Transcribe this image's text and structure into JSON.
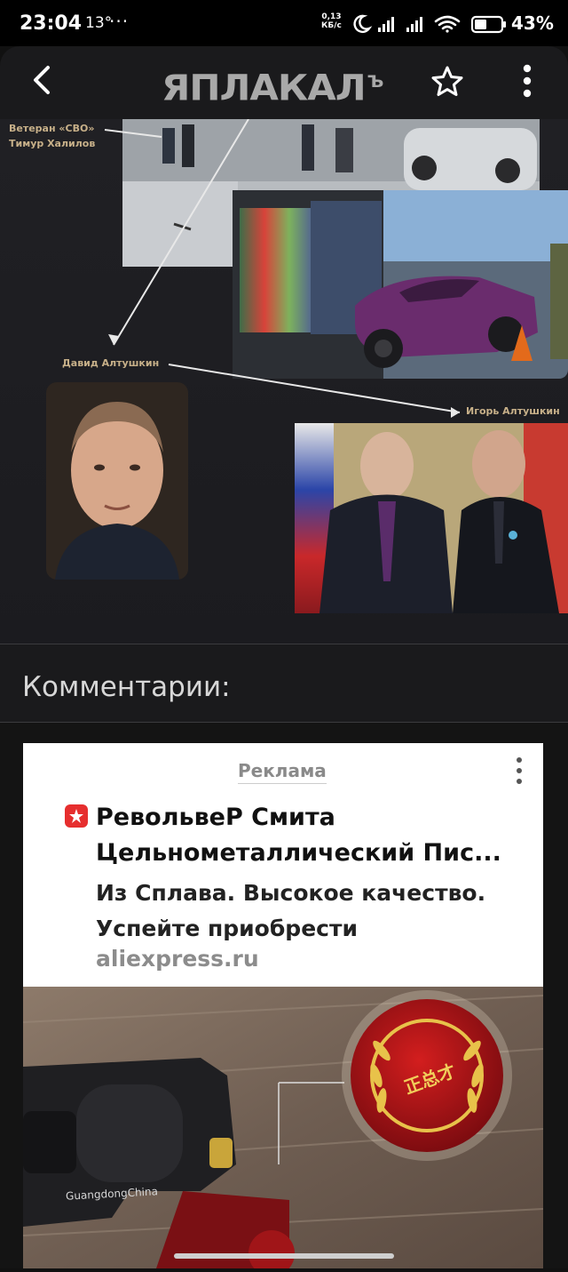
{
  "status_bar": {
    "time": "23:04",
    "temperature": "13°",
    "overflow": "···",
    "net_speed_value": "0,13",
    "net_speed_unit": "КБ/с",
    "battery_percent": "43%"
  },
  "app_bar": {
    "logo_main": "ЯПЛАКАЛ",
    "logo_suffix": "Ъ"
  },
  "article_image": {
    "caption_veteran_line1": "Ветеран «СВО»",
    "caption_veteran_line2": "Тимур Халилов",
    "caption_david": "Давид Алтушкин",
    "caption_igor": "Игорь Алтушкин"
  },
  "comments": {
    "title": "Комментарии:"
  },
  "ad": {
    "label": "Реклама",
    "title_line1": "РевольвеР Смита",
    "title_line2": "Цельнометаллический Пис...",
    "desc_line1": "Из Сплава. Высокое качество.",
    "desc_line2": "Успейте приобрести",
    "domain": "aliexpress.ru",
    "image_text_gun": "GuangdongChina",
    "image_text_emblem": "正总才",
    "badge_color": "#e62e2e"
  }
}
